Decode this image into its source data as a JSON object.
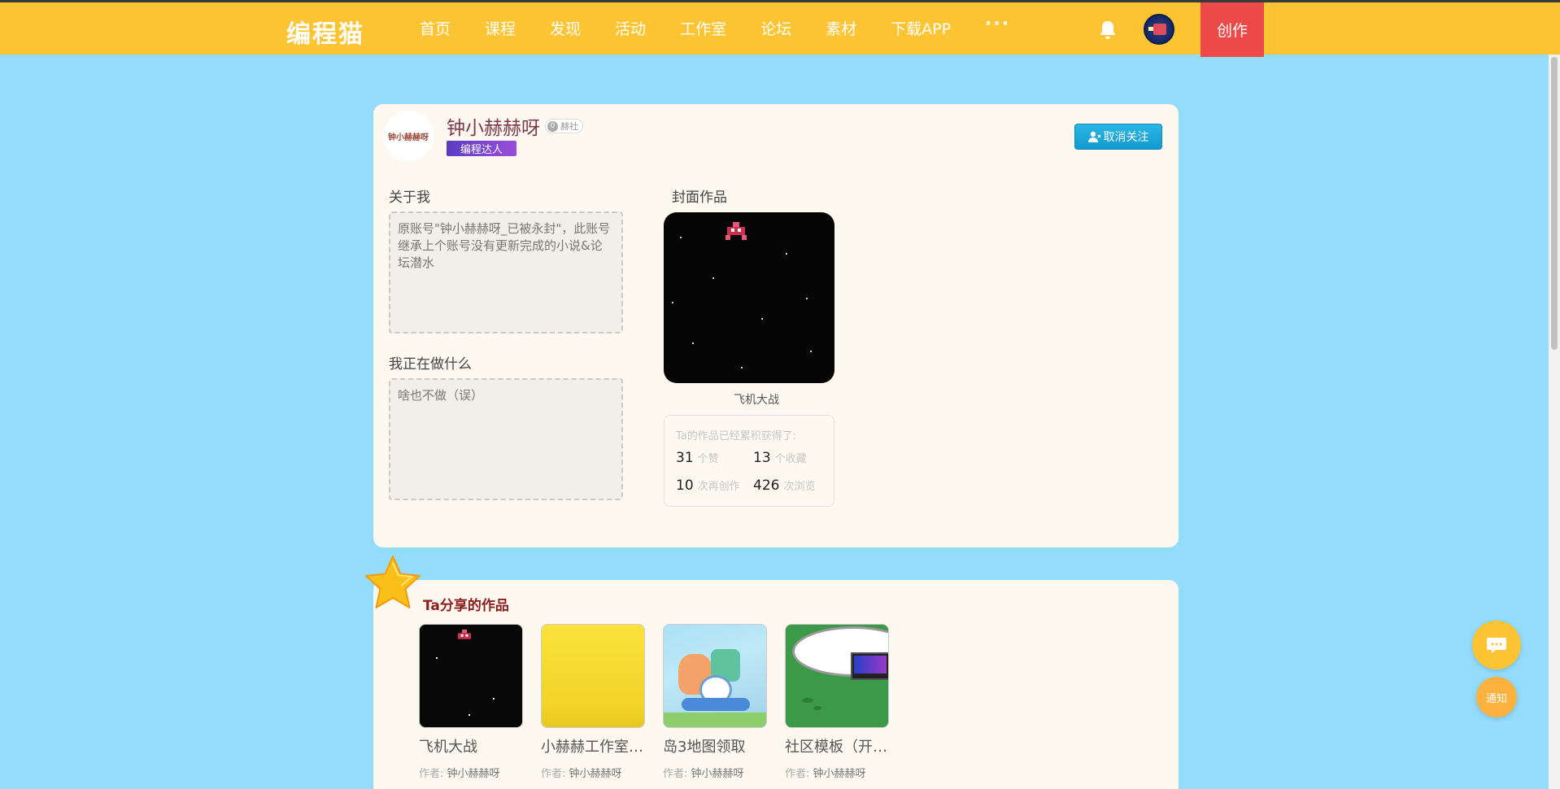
{
  "brand": {
    "logo_text": "编程猫"
  },
  "nav": {
    "items": [
      "首页",
      "课程",
      "发现",
      "活动",
      "工作室",
      "论坛",
      "素材",
      "下载APP"
    ],
    "more_label": "···",
    "create_label": "创作"
  },
  "profile": {
    "avatar_text": "钟小赫赫呀",
    "username": "钟小赫赫呀",
    "club_dot": "0",
    "club": "赫社",
    "title_badge": "编程达人",
    "unfollow_label": "取消关注",
    "about_label": "关于我",
    "about_text": "原账号\"钟小赫赫呀_已被永封\"，此账号继承上个账号没有更新完成的小说&论坛潜水",
    "doing_label": "我正在做什么",
    "doing_text": "啥也不做（误）",
    "cover_label": "封面作品",
    "cover_name": "飞机大战",
    "stats_title": "Ta的作品已经累积获得了:",
    "stats": [
      {
        "value": "31",
        "unit": "个赞"
      },
      {
        "value": "13",
        "unit": "个收藏"
      },
      {
        "value": "10",
        "unit": "次再创作"
      },
      {
        "value": "426",
        "unit": "次浏览"
      }
    ]
  },
  "works": {
    "title": "Ta分享的作品",
    "author_prefix": "作者:",
    "items": [
      {
        "name": "飞机大战",
        "author": "钟小赫赫呀"
      },
      {
        "name": "小赫赫工作室…",
        "author": "钟小赫赫呀"
      },
      {
        "name": "岛3地图领取",
        "author": "钟小赫赫呀"
      },
      {
        "name": "社区模板（开…",
        "author": "钟小赫赫呀"
      }
    ]
  },
  "float": {
    "notify_label": "通知"
  },
  "colors": {
    "nav_bg": "#fec433",
    "page_bg": "#94dcfc",
    "create_bg": "#ee4949",
    "unfollow_bg": "#1aa6dc"
  }
}
